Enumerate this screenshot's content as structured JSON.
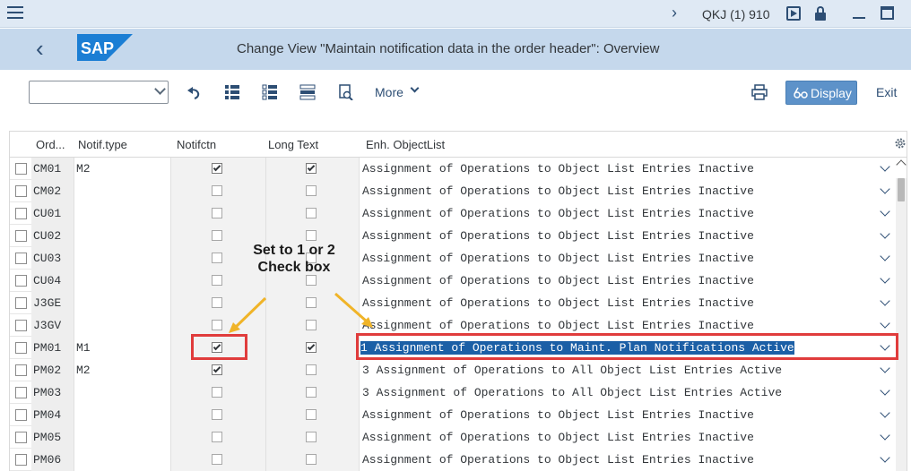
{
  "system": {
    "system_id": "QKJ (1) 910"
  },
  "title_bar": {
    "title": "Change View \"Maintain notification data in the order header\": Overview",
    "logo_text": "SAP"
  },
  "toolbar": {
    "more_label": "More",
    "display_label": "Display",
    "exit_label": "Exit",
    "command_value": ""
  },
  "table": {
    "columns": [
      "Ord...",
      "Notif.type",
      "Notifctn",
      "Long Text",
      "Enh. ObjectList"
    ],
    "rows": [
      {
        "order": "CM01",
        "notif_type": "M2",
        "notifctn": true,
        "long_text": true,
        "enh": "Assignment of Operations to Object List Entries Inactive"
      },
      {
        "order": "CM02",
        "notif_type": "",
        "notifctn": false,
        "long_text": false,
        "enh": "Assignment of Operations to Object List Entries Inactive"
      },
      {
        "order": "CU01",
        "notif_type": "",
        "notifctn": false,
        "long_text": false,
        "enh": "Assignment of Operations to Object List Entries Inactive"
      },
      {
        "order": "CU02",
        "notif_type": "",
        "notifctn": false,
        "long_text": false,
        "enh": "Assignment of Operations to Object List Entries Inactive"
      },
      {
        "order": "CU03",
        "notif_type": "",
        "notifctn": false,
        "long_text": false,
        "enh": "Assignment of Operations to Object List Entries Inactive"
      },
      {
        "order": "CU04",
        "notif_type": "",
        "notifctn": false,
        "long_text": false,
        "enh": "Assignment of Operations to Object List Entries Inactive"
      },
      {
        "order": "J3GE",
        "notif_type": "",
        "notifctn": false,
        "long_text": false,
        "enh": "Assignment of Operations to Object List Entries Inactive"
      },
      {
        "order": "J3GV",
        "notif_type": "",
        "notifctn": false,
        "long_text": false,
        "enh": "Assignment of Operations to Object List Entries Inactive"
      },
      {
        "order": "PM01",
        "notif_type": "M1",
        "notifctn": true,
        "long_text": true,
        "enh": "1 Assignment of Operations to Maint. Plan Notifications Active",
        "highlighted": true
      },
      {
        "order": "PM02",
        "notif_type": "M2",
        "notifctn": true,
        "long_text": false,
        "enh": "3 Assignment of Operations to All Object List Entries Active"
      },
      {
        "order": "PM03",
        "notif_type": "",
        "notifctn": false,
        "long_text": false,
        "enh": "3 Assignment of Operations to All Object List Entries Active"
      },
      {
        "order": "PM04",
        "notif_type": "",
        "notifctn": false,
        "long_text": false,
        "enh": "Assignment of Operations to Object List Entries Inactive"
      },
      {
        "order": "PM05",
        "notif_type": "",
        "notifctn": false,
        "long_text": false,
        "enh": "Assignment of Operations to Object List Entries Inactive"
      },
      {
        "order": "PM06",
        "notif_type": "",
        "notifctn": false,
        "long_text": false,
        "enh": "Assignment of Operations to Object List Entries Inactive"
      }
    ]
  },
  "annotation": {
    "line1": "Set to 1 or 2",
    "line2": "Check box"
  },
  "colors": {
    "accent": "#5d92c9",
    "title_bar": "#c5d8ec",
    "annotation_box": "#e03c3c",
    "annotation_arrow": "#f0b428",
    "selection": "#1b5fa6"
  },
  "icons": [
    "menu-icon",
    "chevron-right-icon",
    "play-icon",
    "lock-icon",
    "minimize-icon",
    "maximize-icon",
    "back-icon",
    "undo-icon",
    "select-all-icon",
    "deselect-all-icon",
    "select-block-icon",
    "search-icon",
    "print-icon",
    "glasses-icon",
    "settings-icon"
  ]
}
